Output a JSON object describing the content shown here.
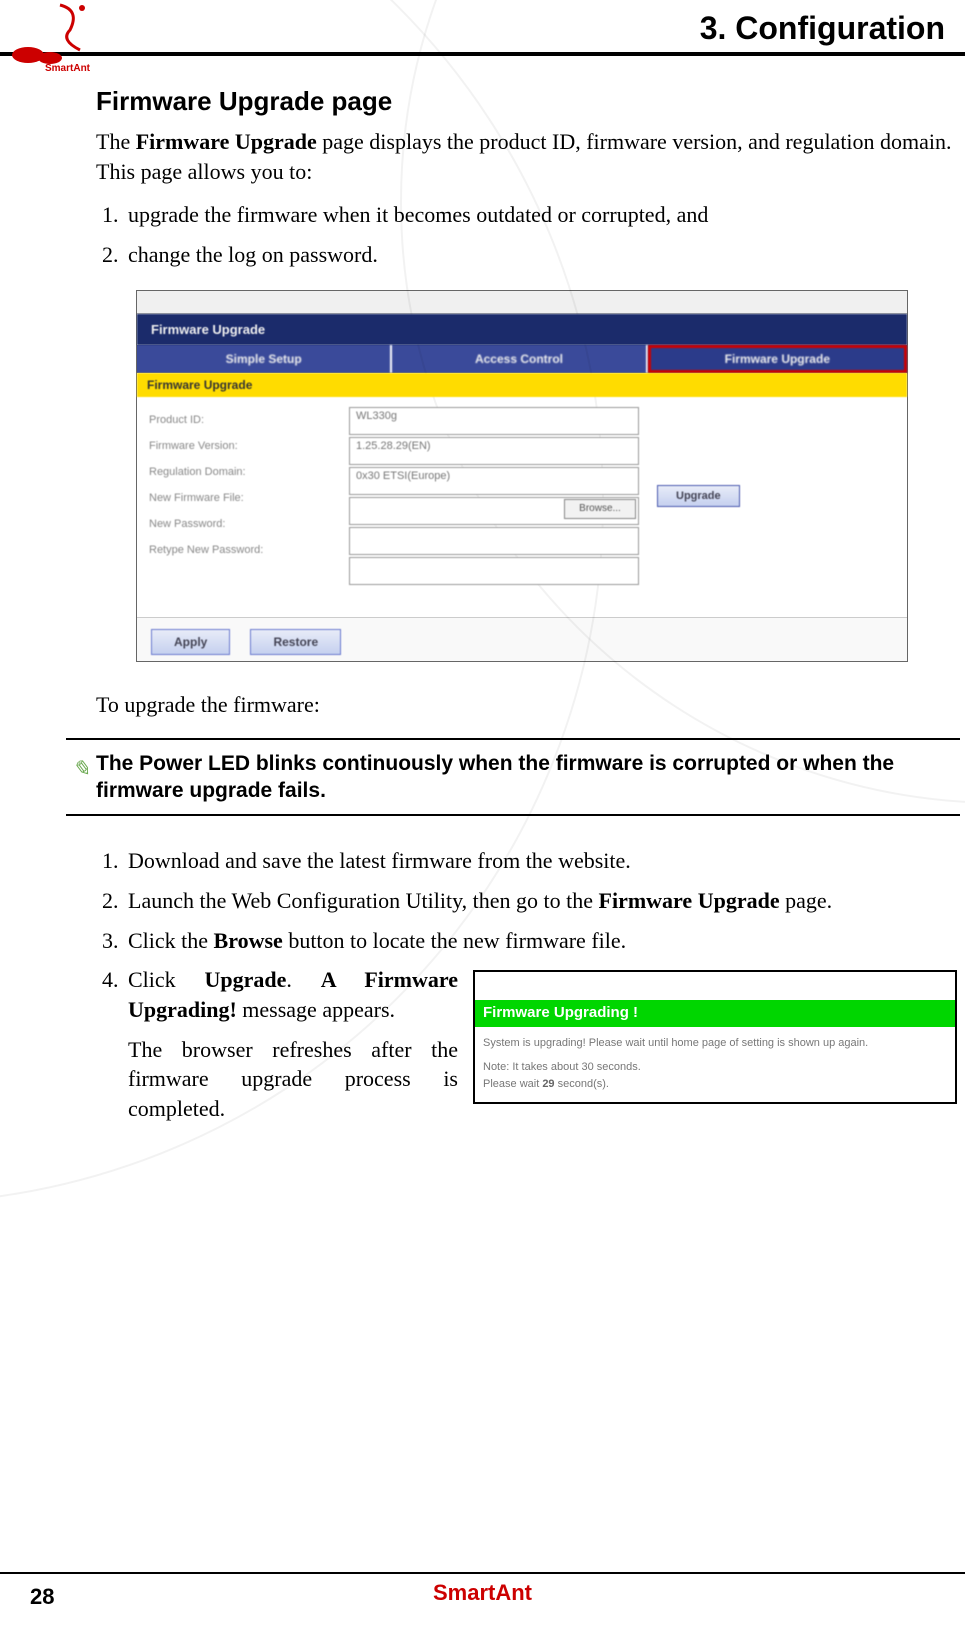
{
  "header": {
    "chapter_title": "3. Configuration",
    "logo_text": "SmartAnt"
  },
  "section_title": "Firmware Upgrade page",
  "intro": {
    "p1_a": "The ",
    "p1_b": "Firmware Upgrade",
    "p1_c": " page displays the product ID, firmware version, and regulation domain. This page allows you to:"
  },
  "list1": {
    "i1": "upgrade the firmware when it becomes outdated or corrupted, and",
    "i2": "change the log on password."
  },
  "screenshot1": {
    "title": "Firmware Upgrade",
    "tab1": "Simple Setup",
    "tab2": "Access Control",
    "tab3": "Firmware Upgrade",
    "yellow": "Firmware Upgrade",
    "labels": {
      "l1": "Product ID:",
      "l2": "Firmware Version:",
      "l3": "Regulation Domain:",
      "l4": "New Firmware File:",
      "l5": "New Password:",
      "l6": "Retype New Password:"
    },
    "fields": {
      "f1": "WL330g",
      "f2": "1.25.28.29(EN)",
      "f3": "0x30 ETSI(Europe)",
      "f4": "",
      "f5": "",
      "f6": ""
    },
    "browse": "Browse...",
    "upgrade": "Upgrade",
    "apply": "Apply",
    "restore": "Restore"
  },
  "upgrade_intro": "To upgrade the firmware:",
  "note_text": "The Power LED blinks continuously when the firmware is corrupted or when the firmware upgrade fails.",
  "steps2": {
    "s1": "Download and save the latest firmware from the  website.",
    "s2_a": "Launch the Web Configuration Utility, then go to the ",
    "s2_b": "Firmware Upgrade",
    "s2_c": " page.",
    "s3_a": "Click the ",
    "s3_b": "Browse",
    "s3_c": " button to locate the new firmware file.",
    "s4_a": "Click ",
    "s4_b": "Upgrade",
    "s4_c": ". ",
    "s4_d": "A Firmware Upgrading!",
    "s4_e": " message appears.",
    "s4_f": "The browser refreshes after the firmware upgrade process is completed."
  },
  "popup": {
    "header": "Firmware Upgrading !",
    "body1": "System is upgrading! Please wait until home page of setting is shown up again.",
    "body2": "Note: It takes about 30 seconds.",
    "body3a": "Please wait ",
    "body3b": "29",
    "body3c": " second(s)."
  },
  "footer": {
    "page_num": "28",
    "brand": "SmartAnt"
  }
}
